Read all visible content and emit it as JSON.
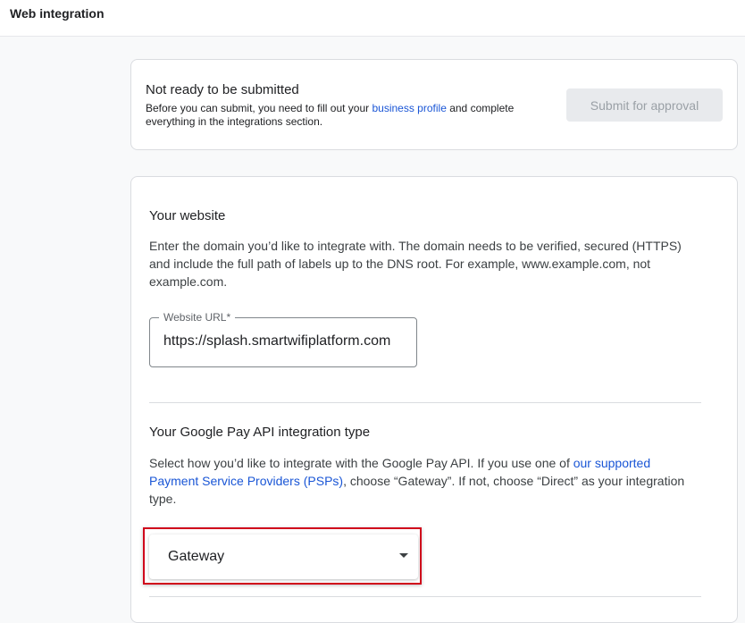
{
  "topbar": {
    "title": "Web integration"
  },
  "status": {
    "title": "Not ready to be submitted",
    "desc_before": "Before you can submit, you need to fill out your ",
    "desc_link": "business profile",
    "desc_after": " and complete everything in the integrations section.",
    "submit_label": "Submit for approval"
  },
  "website": {
    "title": "Your website",
    "description": "Enter the domain you’d like to integrate with. The domain needs to be verified, secured (HTTPS) and include the full path of labels up to the DNS root. For example, www.example.com, not example.com.",
    "url_label": "Website URL*",
    "url_value": "https://splash.smartwifiplatform.com"
  },
  "integration": {
    "title": "Your Google Pay API integration type",
    "desc_before": "Select how you’d like to integrate with the Google Pay API. If you use one of ",
    "desc_link": "our supported Payment Service Providers (PSPs)",
    "desc_after": ", choose “Gateway”. If not, choose “Direct” as your integration type.",
    "selected": "Gateway"
  },
  "colors": {
    "link": "#1a56d6",
    "highlight": "#d0021b",
    "disabled_button": "#e8eaed"
  }
}
